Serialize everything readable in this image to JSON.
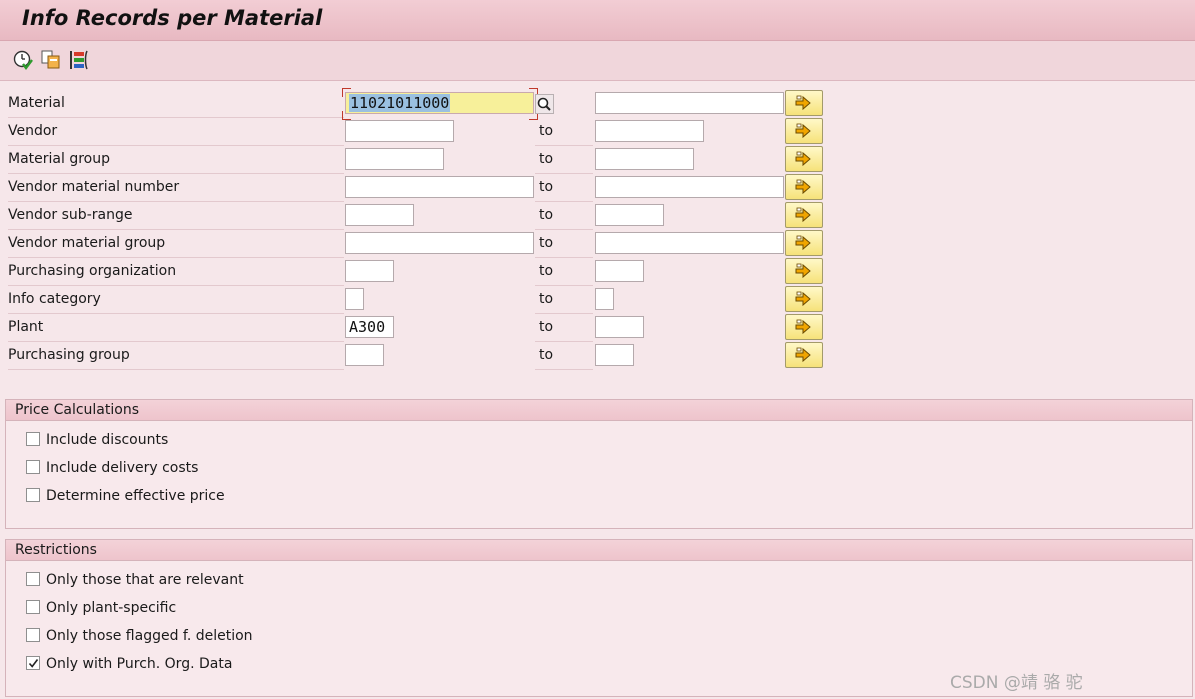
{
  "window": {
    "title": "Info Records per Material"
  },
  "toolbar": {
    "icons": [
      "execute-icon",
      "get-variant-icon",
      "selection-options-icon"
    ]
  },
  "selection": {
    "to_label": "to",
    "rows": [
      {
        "label": "Material",
        "from": "11021011000",
        "to": ""
      },
      {
        "label": "Vendor",
        "from": "",
        "to": ""
      },
      {
        "label": "Material group",
        "from": "",
        "to": ""
      },
      {
        "label": "Vendor material number",
        "from": "",
        "to": ""
      },
      {
        "label": "Vendor sub-range",
        "from": "",
        "to": ""
      },
      {
        "label": "Vendor material group",
        "from": "",
        "to": ""
      },
      {
        "label": "Purchasing organization",
        "from": "",
        "to": ""
      },
      {
        "label": "Info category",
        "from": "",
        "to": ""
      },
      {
        "label": "Plant",
        "from": "A300",
        "to": ""
      },
      {
        "label": "Purchasing group",
        "from": "",
        "to": ""
      }
    ]
  },
  "price_calc": {
    "title": "Price Calculations",
    "options": [
      {
        "label": "Include discounts",
        "checked": false
      },
      {
        "label": "Include delivery costs",
        "checked": false
      },
      {
        "label": "Determine effective price",
        "checked": false
      }
    ]
  },
  "restrictions": {
    "title": "Restrictions",
    "options": [
      {
        "label": "Only those that are relevant",
        "checked": false
      },
      {
        "label": "Only plant-specific",
        "checked": false
      },
      {
        "label": "Only those flagged f. deletion",
        "checked": false
      },
      {
        "label": "Only with Purch. Org. Data",
        "checked": true
      }
    ]
  },
  "watermark": "CSDN @靖 骆 驼"
}
